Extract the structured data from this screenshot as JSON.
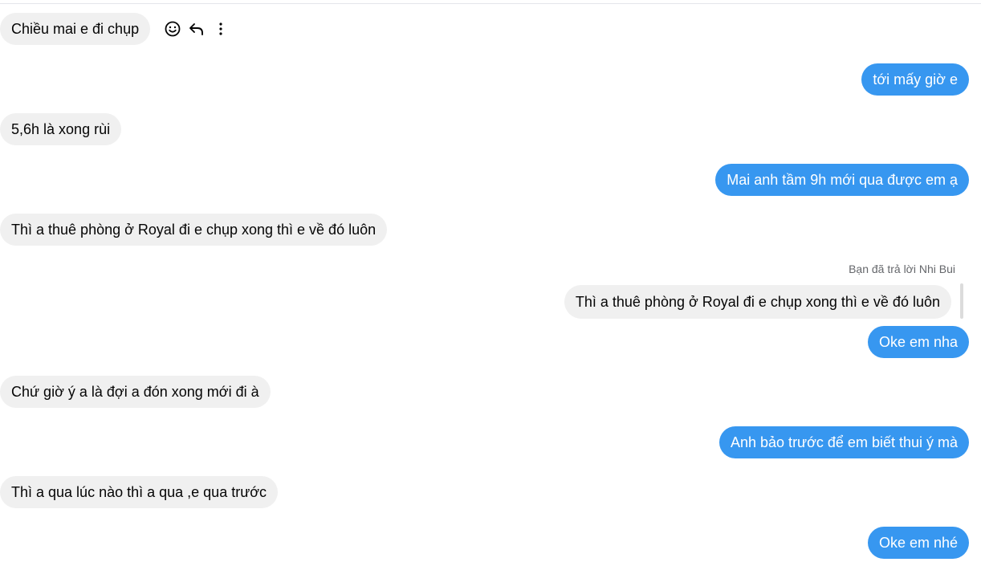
{
  "messages": [
    {
      "from": "them",
      "text": "Chiều mai e đi chụp"
    },
    {
      "from": "me",
      "text": "tới mấy giờ e"
    },
    {
      "from": "them",
      "text": "5,6h là xong rùi"
    },
    {
      "from": "me",
      "text": "Mai anh tầm 9h mới qua được em ạ"
    },
    {
      "from": "them",
      "text": "Thì a thuê phòng ở Royal đi e chụp xong thì e về đó luôn"
    },
    {
      "from": "me",
      "text": "Oke em nha"
    },
    {
      "from": "them",
      "text": "Chứ giờ ý a là đợi a đón xong mới đi à"
    },
    {
      "from": "me",
      "text": "Anh bảo trước để em biết thui ý mà"
    },
    {
      "from": "them",
      "text": "Thì a qua lúc nào thì a qua ,e qua trước"
    },
    {
      "from": "me",
      "text": "Oke em nhé"
    }
  ],
  "reply": {
    "meta": "Bạn đã trả lời Nhi Bui",
    "quoted_text": "Thì a thuê phòng ở Royal đi e chụp xong thì e về đó luôn"
  },
  "hover_actions": {
    "react_icon": "smiley-icon",
    "reply_icon": "reply-arrow-icon",
    "more_icon": "more-vertical-icon"
  },
  "colors": {
    "outgoing_bubble": "#3797f0",
    "incoming_bubble": "#f0f0f0",
    "meta_text": "#65676b"
  }
}
